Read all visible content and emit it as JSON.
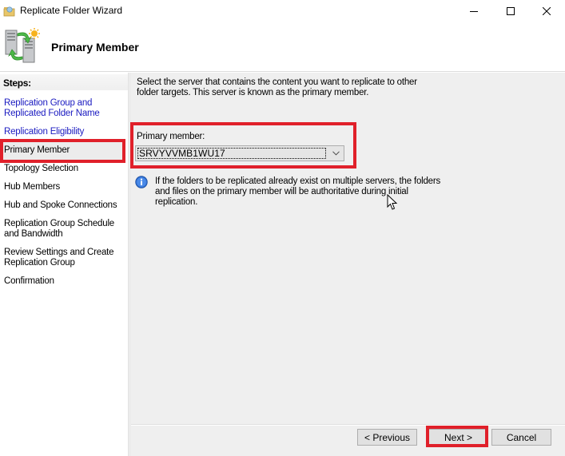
{
  "window": {
    "title": "Replicate Folder Wizard",
    "controls": [
      "minimize",
      "maximize",
      "close"
    ]
  },
  "header": {
    "title": "Primary Member",
    "icon": "replication-servers-icon"
  },
  "steps": {
    "title": "Steps:",
    "items": [
      {
        "label": "Replication Group and Replicated Folder Name",
        "state": "completed"
      },
      {
        "label": "Replication Eligibility",
        "state": "completed"
      },
      {
        "label": "Primary Member",
        "state": "current"
      },
      {
        "label": "Topology Selection",
        "state": "pending"
      },
      {
        "label": "Hub Members",
        "state": "pending"
      },
      {
        "label": "Hub and Spoke Connections",
        "state": "pending"
      },
      {
        "label": "Replication Group Schedule and Bandwidth",
        "state": "pending"
      },
      {
        "label": "Review Settings and Create Replication Group",
        "state": "pending"
      },
      {
        "label": "Confirmation",
        "state": "pending"
      }
    ]
  },
  "content": {
    "intro": "Select the server that contains the content you want to replicate to other folder targets. This server is known as the primary member.",
    "primary_member_label": "Primary member:",
    "primary_member_value": "SRVYVVMB1WU17",
    "info_text": "If the folders to be replicated already exist on multiple servers, the folders and files on the primary member will be authoritative during initial replication."
  },
  "footer": {
    "previous_label": "< Previous",
    "next_label": "Next >",
    "cancel_label": "Cancel"
  },
  "colors": {
    "link": "#1a1ac0",
    "highlight": "#e0202a",
    "panel": "#efefef"
  }
}
